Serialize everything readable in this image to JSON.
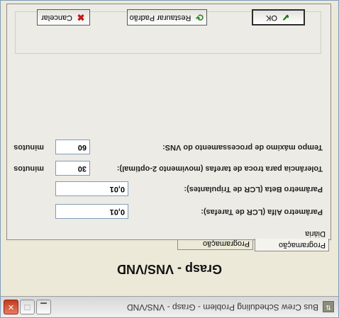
{
  "window": {
    "title": "Bus Crew Scheduling Problem - Grasp - VNS/VND",
    "icon": "app-icon",
    "minimize_glyph": "▁",
    "maximize_glyph": "☐",
    "close_glyph": "✕"
  },
  "heading": "Grasp - VNS/VND",
  "tabs": [
    {
      "label": "Programação Diária",
      "active": true
    },
    {
      "label": "Programação Mensal",
      "active": false
    }
  ],
  "form": {
    "alfa_label": "Parâmetro Alfa (LCR de Tarefas):",
    "alfa_value": "0,01",
    "beta_label": "Parâmetro Beta (LCR de Tripulantes):",
    "beta_value": "0,01",
    "tolerancia_label": "Tolerância para troca de tarefas (movimento 2-optimal):",
    "tolerancia_value": "30",
    "tolerancia_unit": "minutos",
    "tempo_label": "Tempo máximo de processamento do VNS:",
    "tempo_value": "60",
    "tempo_unit": "minutos"
  },
  "buttons": {
    "ok_label": "OK",
    "restore_label": "Restaurar Padrão",
    "cancel_label": "Cancelar"
  }
}
